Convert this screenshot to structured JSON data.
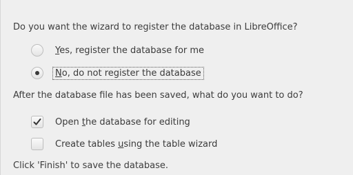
{
  "questions": {
    "register": "Do you want the wizard to register the database in LibreOffice?",
    "after_save": "After the database file has been saved, what do you want to do?"
  },
  "register_options": [
    {
      "label_mnemonic": "Y",
      "label_rest": "es, register the database for me",
      "checked": false
    },
    {
      "label_mnemonic": "N",
      "label_rest": "o, do not register the database",
      "checked": true,
      "focused": true
    }
  ],
  "after_options": [
    {
      "label_before": "Open ",
      "label_mnemonic": "t",
      "label_after": "he database for editing",
      "checked": true
    },
    {
      "label_before": "Create tables ",
      "label_mnemonic": "u",
      "label_after": "sing the table wizard",
      "checked": false
    }
  ],
  "footer": "Click 'Finish' to save the database."
}
